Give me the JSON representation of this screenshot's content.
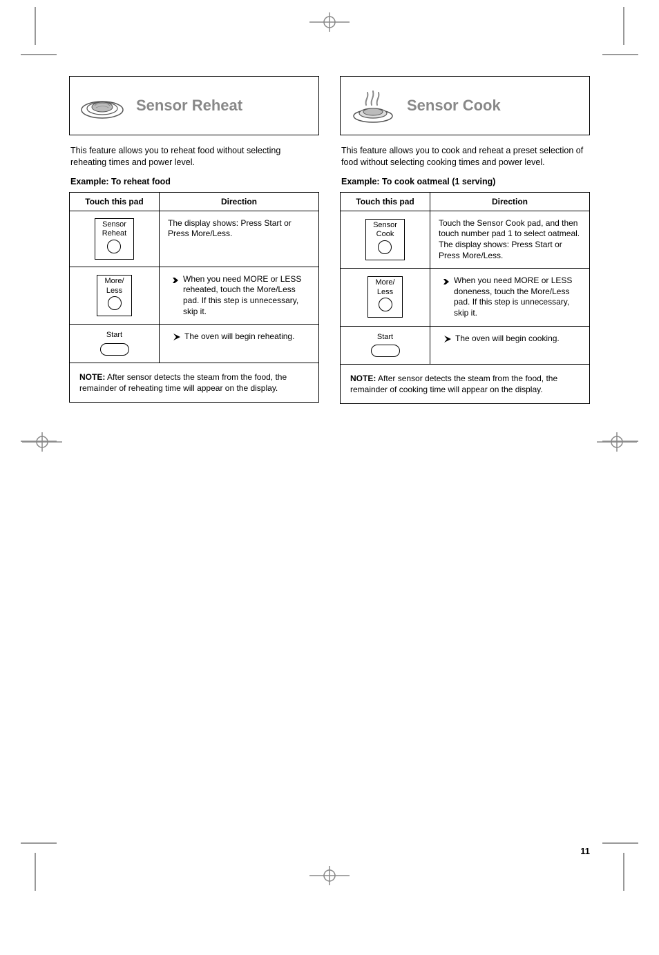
{
  "left": {
    "title": "Sensor Reheat",
    "intro": "This feature allows you to reheat food without selecting reheating times and power level.",
    "example": "Example: To reheat food",
    "head_touch": "Touch this pad",
    "head_direction": "Direction",
    "steps": [
      {
        "btn_top": "Sensor",
        "btn_bot": "Reheat",
        "shape": "circle",
        "direction": "The display shows: Press Start or Press More/Less."
      },
      {
        "btn_top": "More/",
        "btn_bot": "Less",
        "shape": "circle",
        "direction": "When you need MORE or LESS reheated, touch the More/Less pad. If this step is unnecessary, skip it."
      },
      {
        "btn_top": "Start",
        "btn_bot": "",
        "shape": "oval",
        "direction": "The oven will begin reheating."
      }
    ],
    "note_label": "NOTE:",
    "note_text": "After sensor detects the steam from the food, the remainder of reheating time will appear on the display."
  },
  "right": {
    "title": "Sensor Cook",
    "intro": "This feature allows you to cook and reheat a preset selection of food without selecting cooking times and power level.",
    "example": "Example: To cook oatmeal (1 serving)",
    "head_touch": "Touch this pad",
    "head_direction": "Direction",
    "steps": [
      {
        "btn_top": "Sensor",
        "btn_bot": "Cook",
        "shape": "circle",
        "direction": "Touch the Sensor Cook pad, and then touch number pad 1 to select oatmeal. The display shows: Press Start or Press More/Less."
      },
      {
        "btn_top": "More/",
        "btn_bot": "Less",
        "shape": "circle",
        "direction": "When you need MORE or LESS doneness, touch the More/Less pad. If this step is unnecessary, skip it."
      },
      {
        "btn_top": "Start",
        "btn_bot": "",
        "shape": "oval",
        "direction": "The oven will begin cooking."
      }
    ],
    "note_label": "NOTE:",
    "note_text": "After sensor detects the steam from the food, the remainder of cooking time will appear on the display."
  },
  "page_num": "11"
}
